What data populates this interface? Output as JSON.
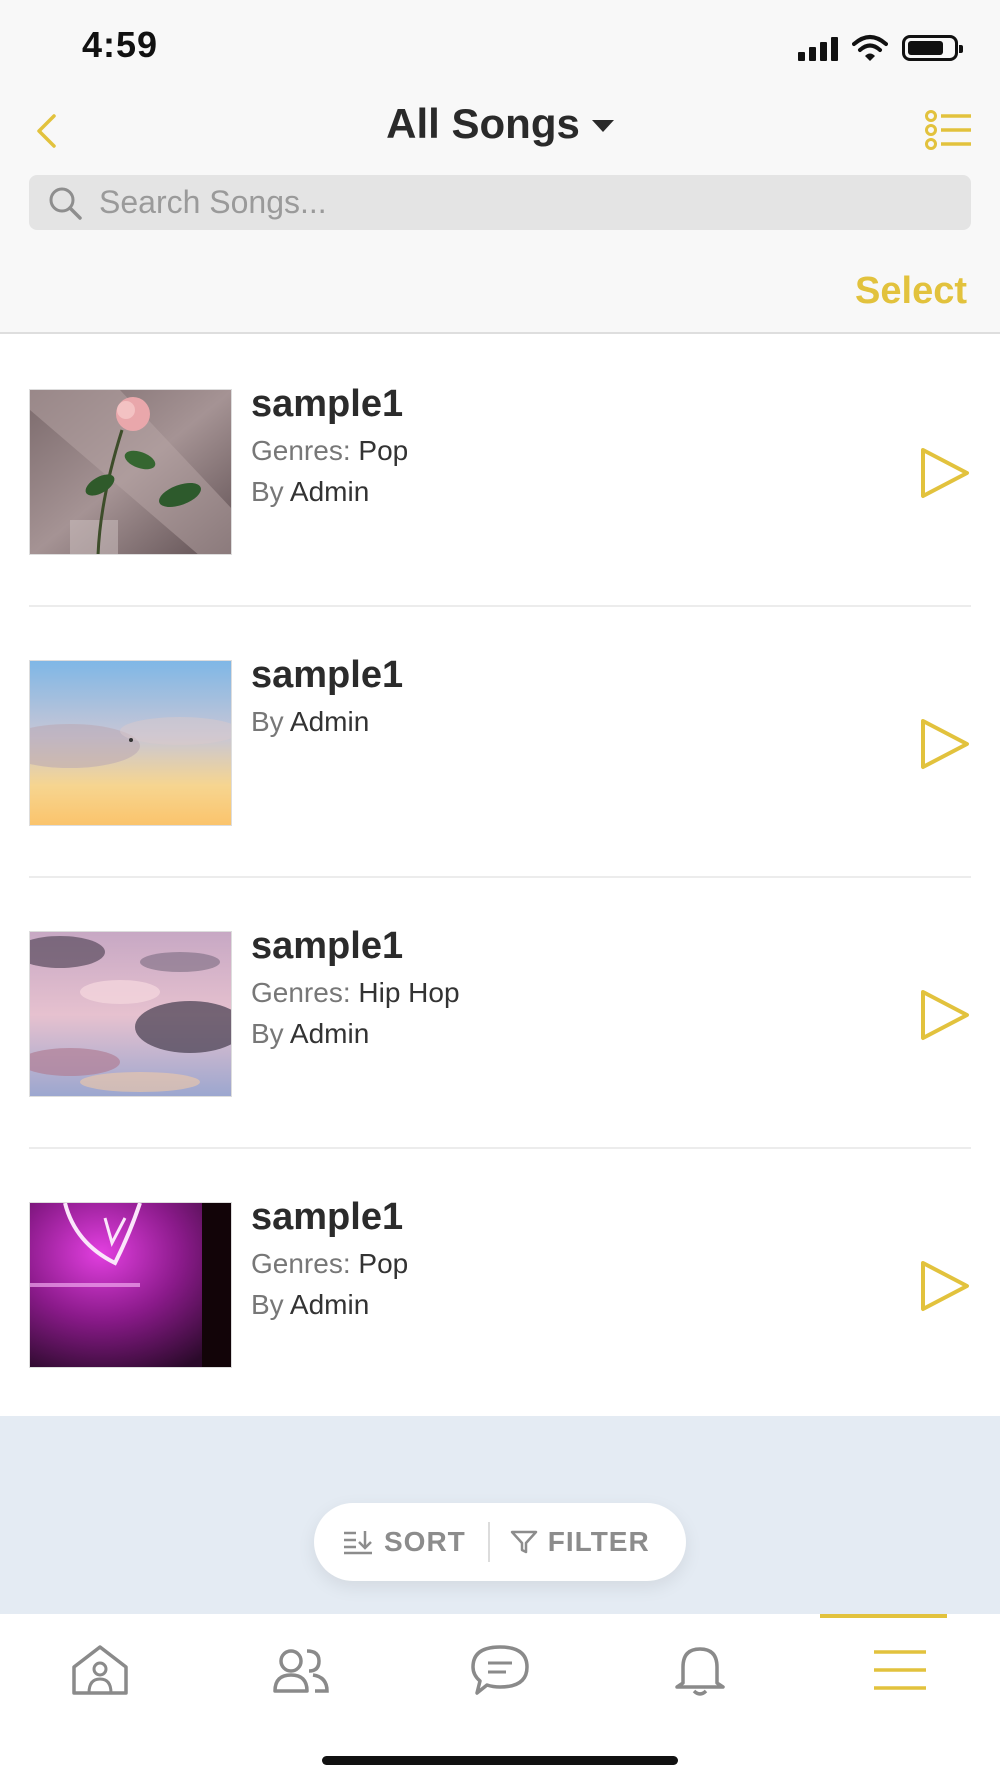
{
  "status_bar": {
    "time": "4:59"
  },
  "header": {
    "title": "All Songs",
    "back_icon": "chevron-left-icon",
    "view_toggle_icon": "list-icon",
    "select_label": "Select"
  },
  "search": {
    "placeholder": "Search Songs...",
    "value": ""
  },
  "songs": [
    {
      "title": "sample1",
      "genres_label": "Genres:",
      "genres": "Pop",
      "by_label": "By",
      "artist": "Admin",
      "art": "pink-rose"
    },
    {
      "title": "sample1",
      "by_label": "By",
      "artist": "Admin",
      "art": "sunset-sky"
    },
    {
      "title": "sample1",
      "genres_label": "Genres:",
      "genres": "Hip Hop",
      "by_label": "By",
      "artist": "Admin",
      "art": "pink-clouds"
    },
    {
      "title": "sample1",
      "genres_label": "Genres:",
      "genres": "Pop",
      "by_label": "By",
      "artist": "Admin",
      "art": "neon-heart"
    }
  ],
  "sort_filter": {
    "sort_label": "SORT",
    "filter_label": "FILTER"
  },
  "tabbar": {
    "tabs": [
      {
        "icon": "home-icon"
      },
      {
        "icon": "people-icon"
      },
      {
        "icon": "chat-icon"
      },
      {
        "icon": "bell-icon"
      },
      {
        "icon": "menu-icon",
        "active": true
      }
    ]
  },
  "colors": {
    "accent": "#e2c23d",
    "background": "#f8f8f8",
    "tint": "#e4ebf3"
  }
}
